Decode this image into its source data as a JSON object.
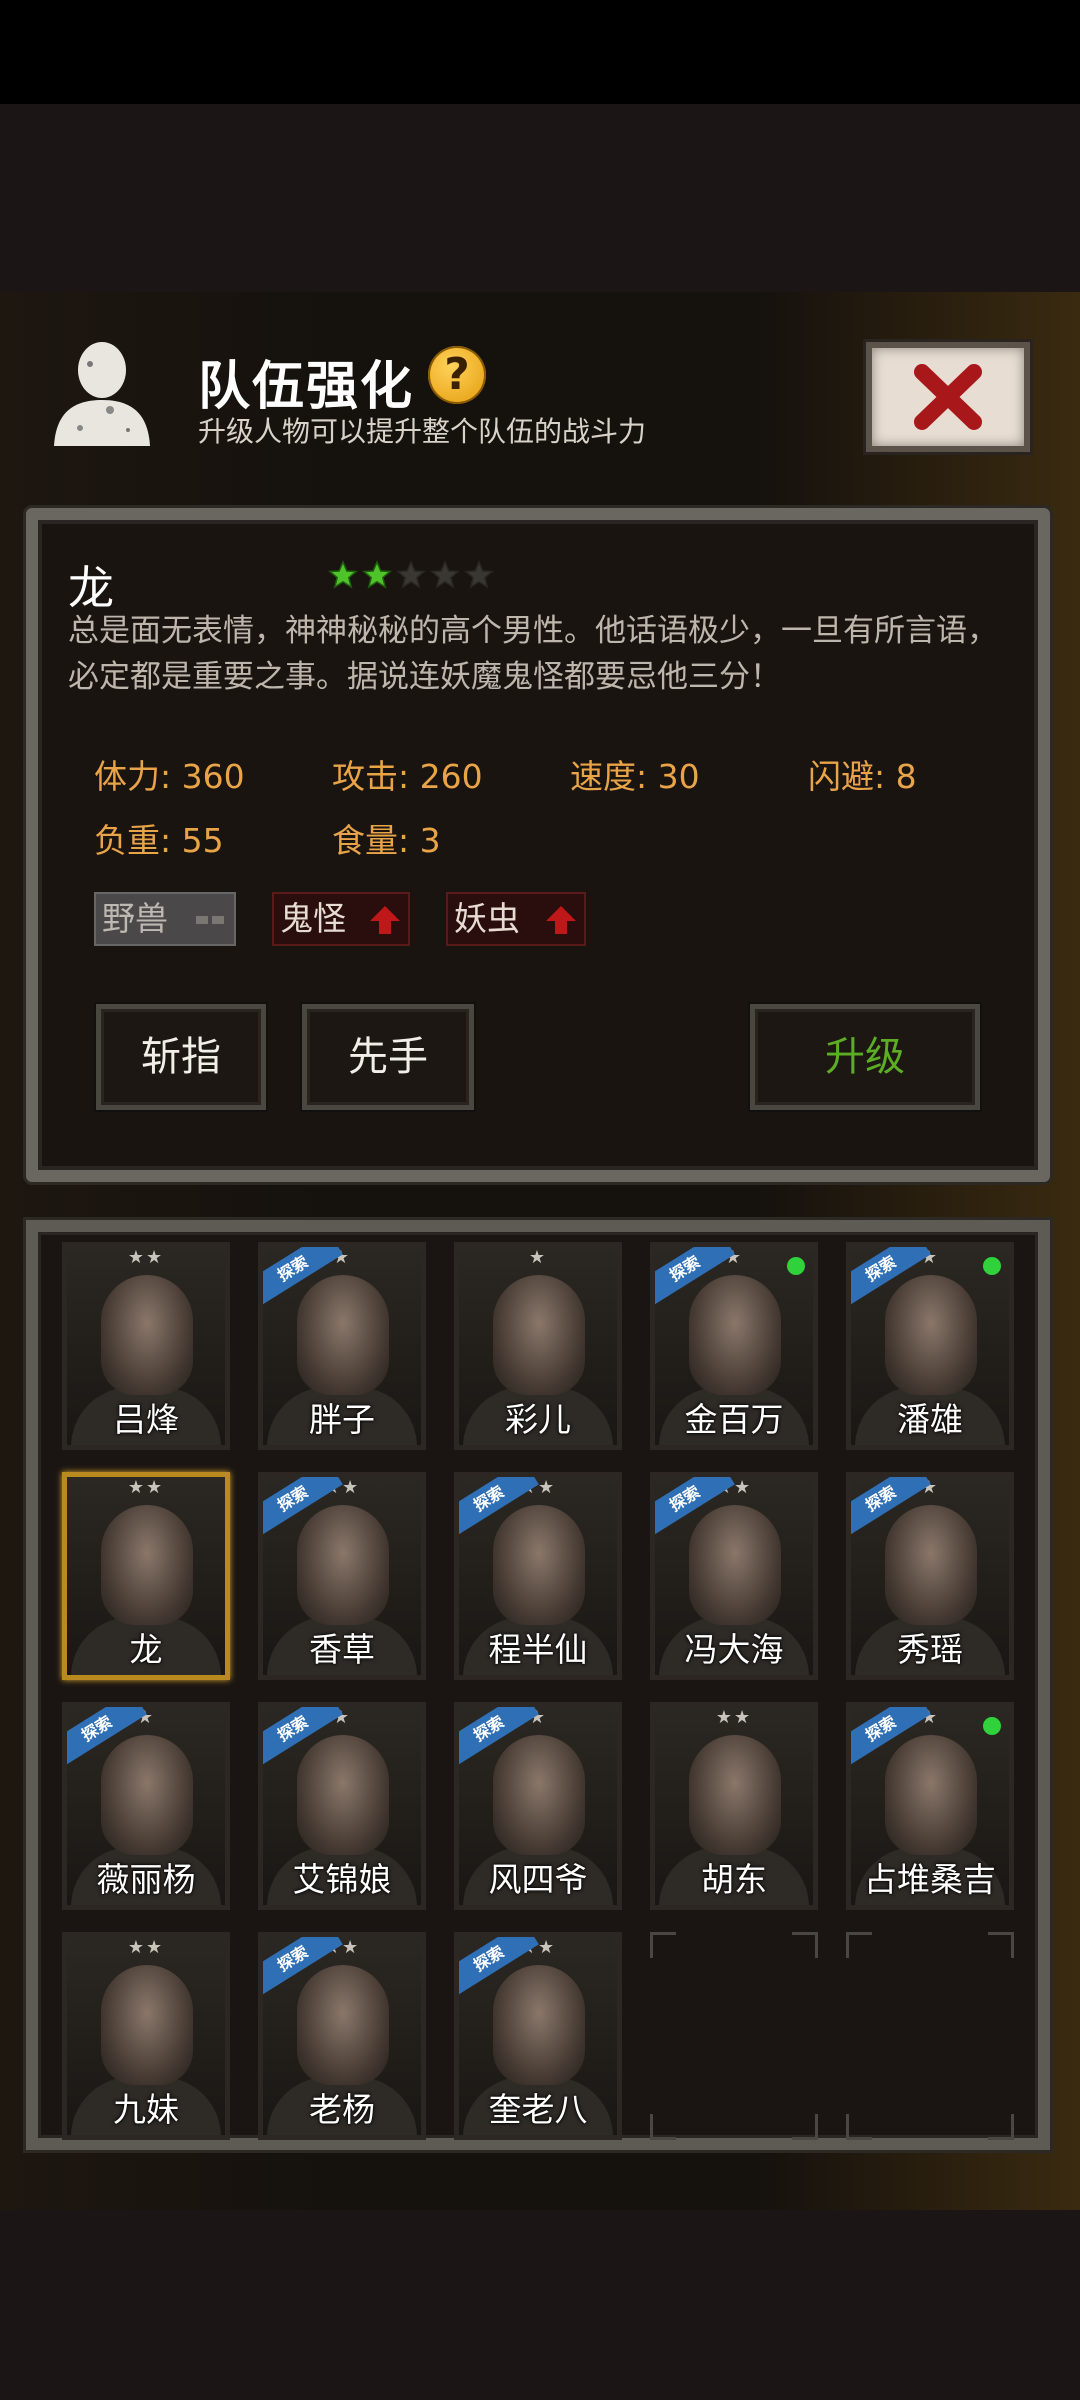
{
  "header": {
    "title": "队伍强化",
    "help_glyph": "?",
    "subtitle": "升级人物可以提升整个队伍的战斗力",
    "close_icon": "close-x-icon"
  },
  "character": {
    "name": "龙",
    "stars_filled": 2,
    "stars_total": 5,
    "description": "总是面无表情，神神秘秘的高个男性。他话语极少，一旦有所言语，必定都是重要之事。据说连妖魔鬼怪都要忌他三分！",
    "stats": {
      "hp": "体力: 360",
      "attack": "攻击: 260",
      "speed": "速度: 30",
      "dodge": "闪避: 8",
      "load": "负重: 55",
      "food": "食量: 3"
    },
    "tags": {
      "beast": "野兽",
      "ghost": "鬼怪",
      "insect": "妖虫"
    }
  },
  "actions": {
    "chop": "斩指",
    "first": "先手",
    "upgrade": "升级"
  },
  "explore_label": "探索",
  "roster": [
    {
      "name": "吕烽",
      "stars": "★★",
      "explore": false,
      "online": false
    },
    {
      "name": "胖子",
      "stars": "★",
      "explore": true,
      "online": false
    },
    {
      "name": "彩儿",
      "stars": "★",
      "explore": false,
      "online": false
    },
    {
      "name": "金百万",
      "stars": "★",
      "explore": true,
      "online": true
    },
    {
      "name": "潘雄",
      "stars": "★",
      "explore": true,
      "online": true
    },
    {
      "name": "龙",
      "stars": "★★",
      "explore": false,
      "online": false,
      "selected": true
    },
    {
      "name": "香草",
      "stars": "★★",
      "explore": true,
      "online": false
    },
    {
      "name": "程半仙",
      "stars": "★★",
      "explore": true,
      "online": false
    },
    {
      "name": "冯大海",
      "stars": "★★",
      "explore": true,
      "online": false
    },
    {
      "name": "秀瑶",
      "stars": "★",
      "explore": true,
      "online": false
    },
    {
      "name": "薇丽杨",
      "stars": "★",
      "explore": true,
      "online": false
    },
    {
      "name": "艾锦娘",
      "stars": "★",
      "explore": true,
      "online": false
    },
    {
      "name": "风四爷",
      "stars": "★",
      "explore": true,
      "online": false
    },
    {
      "name": "胡东",
      "stars": "★★",
      "explore": false,
      "online": false
    },
    {
      "name": "占堆桑吉",
      "stars": "★",
      "explore": true,
      "online": true
    },
    {
      "name": "九妹",
      "stars": "★★",
      "explore": false,
      "online": false
    },
    {
      "name": "老杨",
      "stars": "★★",
      "explore": true,
      "online": false
    },
    {
      "name": "奎老八",
      "stars": "★★",
      "explore": true,
      "online": false
    }
  ],
  "empty_slots": 2,
  "colors": {
    "stat_text": "#e9a448",
    "upgrade_text": "#5cad24",
    "explore_ribbon": "#2f6fb5",
    "online_dot": "#2fd23a",
    "star_filled": "#4fc32a"
  }
}
